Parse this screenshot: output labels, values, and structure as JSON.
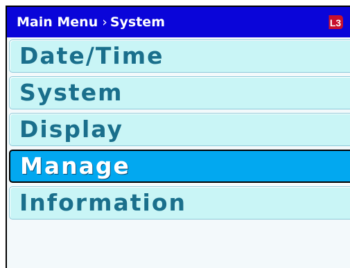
{
  "header": {
    "breadcrumb_root": "Main Menu",
    "breadcrumb_separator": "›",
    "breadcrumb_current": "System",
    "logo_text": "L3"
  },
  "menu": {
    "items": [
      {
        "label": "Date/Time",
        "selected": false
      },
      {
        "label": "System",
        "selected": false
      },
      {
        "label": "Display",
        "selected": false
      },
      {
        "label": "Manage",
        "selected": true
      },
      {
        "label": "Information",
        "selected": false
      }
    ]
  },
  "colors": {
    "header_bg": "#0a05d9",
    "item_bg": "#c9f5f6",
    "item_text": "#1a6f8c",
    "selected_bg": "#02a8f0",
    "selected_text": "#ffffff",
    "logo_red": "#c8102e"
  },
  "icons": {
    "logo": "l3-logo-icon"
  }
}
